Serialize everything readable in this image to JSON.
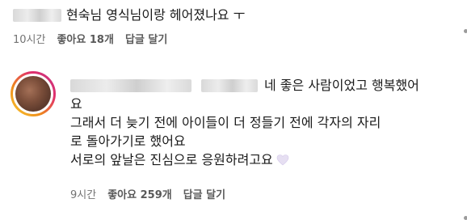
{
  "comment_1": {
    "text": "현숙님 영식님이랑 헤어졌나요 ㅜ",
    "time": "10시간",
    "likes": "좋아요 18개",
    "reply": "답글 달기"
  },
  "comment_2": {
    "line_1_end": "네 좋은 사람이었고 행복했어",
    "line_2": "요",
    "line_3": "그래서 더 늦기 전에 아이들이 더 정들기 전에 각자의 자리",
    "line_4": "로 돌아가기로 했어요",
    "line_5": "서로의 앞날은 진심으로 응원하려고요",
    "time": "9시간",
    "likes": "좋아요 259개",
    "reply": "답글 달기"
  },
  "colors": {
    "meta_text": "#737373",
    "heart": "#e6dff2"
  }
}
